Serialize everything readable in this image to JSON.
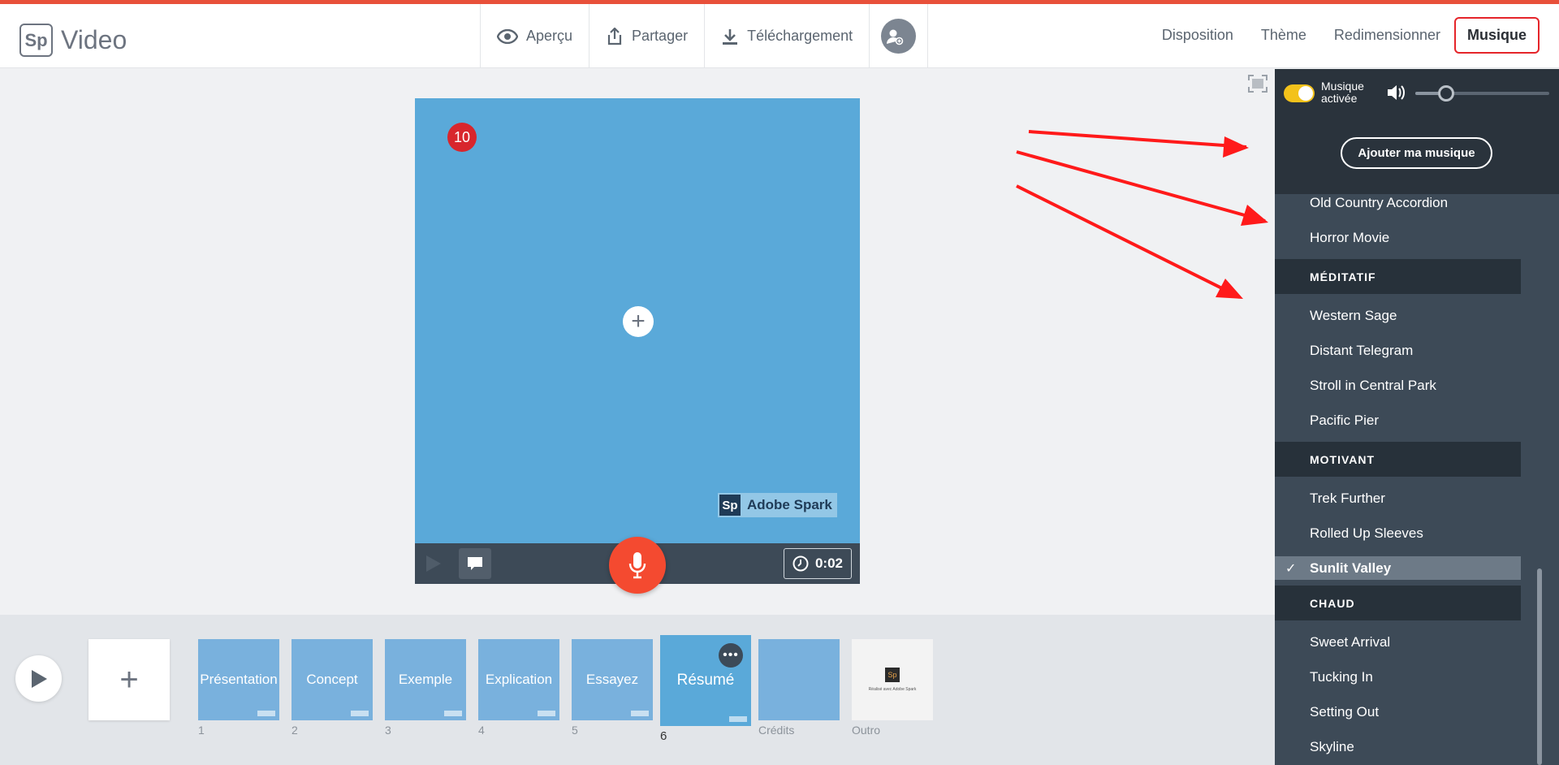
{
  "app": {
    "logo_abbr": "Sp",
    "name": "Video"
  },
  "toolbar": {
    "preview": "Aperçu",
    "share": "Partager",
    "download": "Téléchargement"
  },
  "nav": {
    "layout": "Disposition",
    "theme": "Thème",
    "resize": "Redimensionner",
    "music": "Musique"
  },
  "slide": {
    "badge": "10",
    "watermark_abbr": "Sp",
    "watermark": "Adobe Spark",
    "timer": "0:02"
  },
  "timeline": {
    "thumbs": [
      {
        "label": "Présentation",
        "num": "1"
      },
      {
        "label": "Concept",
        "num": "2"
      },
      {
        "label": "Exemple",
        "num": "3"
      },
      {
        "label": "Explication",
        "num": "4"
      },
      {
        "label": "Essayez",
        "num": "5"
      },
      {
        "label": "Résumé",
        "num": "6"
      },
      {
        "label": "",
        "num": "Crédits"
      },
      {
        "label": "",
        "num": "Outro"
      }
    ],
    "outro_logo": "Sp",
    "outro_text": "Réalisé avec Adobe Spark",
    "more": "•••"
  },
  "music": {
    "toggle_label_1": "Musique",
    "toggle_label_2": "activée",
    "add_button": "Ajouter ma musique",
    "items_top": [
      "Old Country Accordion",
      "Horror Movie"
    ],
    "cat_meditatif": "MÉDITATIF",
    "items_meditatif": [
      "Western Sage",
      "Distant Telegram",
      "Stroll in Central Park",
      "Pacific Pier"
    ],
    "cat_motivant": "MOTIVANT",
    "items_motivant": [
      "Trek Further",
      "Rolled Up Sleeves",
      "Sunlit Valley"
    ],
    "cat_chaud": "CHAUD",
    "items_chaud": [
      "Sweet Arrival",
      "Tucking In",
      "Setting Out",
      "Skyline"
    ],
    "volume": 0.2
  },
  "colors": {
    "accent": "#e8503a",
    "slide_bg": "#5aa9d9",
    "panel_bg": "#3d4a57",
    "mic": "#f44a30",
    "toggle_on": "#f3c21b",
    "annotation_arrow": "#ff0000"
  }
}
